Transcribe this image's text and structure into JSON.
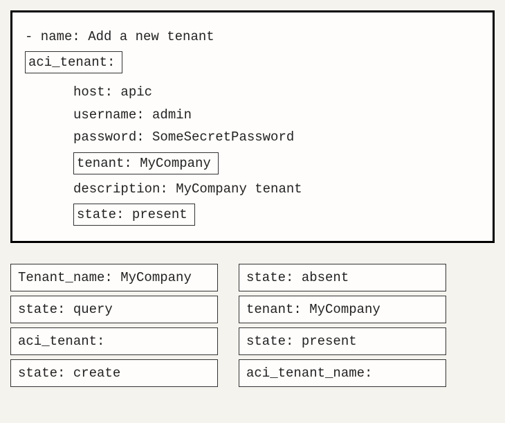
{
  "code": {
    "line_name": "- name: Add a new tenant",
    "module_box": "aci_tenant:",
    "line_host": "host: apic",
    "line_username": "username: admin",
    "line_password": "password: SomeSecretPassword",
    "tenant_box": "tenant: MyCompany",
    "line_description": "description: MyCompany tenant",
    "state_box": "state: present"
  },
  "options": {
    "left": [
      "Tenant_name: MyCompany",
      "state: query",
      "aci_tenant:",
      "state: create"
    ],
    "right": [
      "state: absent",
      "tenant: MyCompany",
      "state: present",
      "aci_tenant_name:"
    ]
  }
}
